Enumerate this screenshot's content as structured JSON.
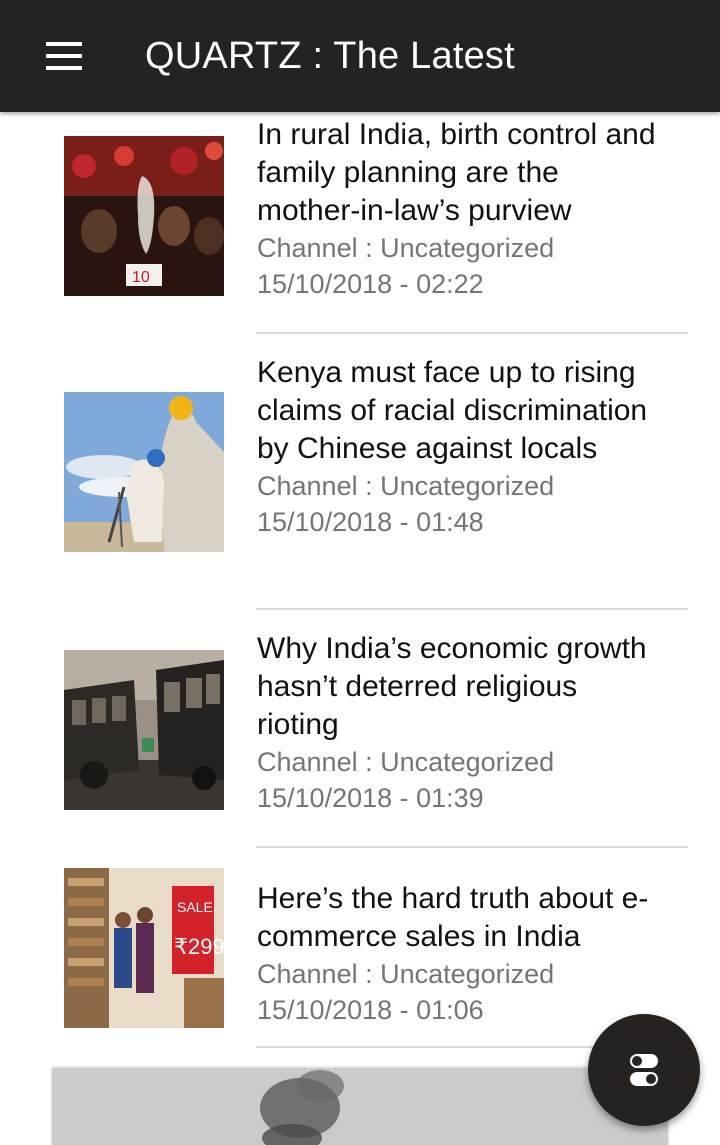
{
  "header": {
    "title": "QUARTZ : The Latest",
    "menu_icon": "hamburger-menu-icon"
  },
  "articles": [
    {
      "title": "In rural India, birth control and family planning are the mother-in-law’s purview",
      "channel": "Channel : Uncategorized",
      "datetime": "15/10/2018 - 02:22"
    },
    {
      "title": "Kenya must face up to rising claims of racial discrimination by Chinese against locals",
      "channel": "Channel : Uncategorized",
      "datetime": "15/10/2018 - 01:48"
    },
    {
      "title": "Why India’s economic growth hasn’t deterred religious rioting",
      "channel": "Channel : Uncategorized",
      "datetime": "15/10/2018 - 01:39"
    },
    {
      "title": "Here’s the hard truth about e-commerce sales in India",
      "channel": "Channel : Uncategorized",
      "datetime": "15/10/2018 - 01:06"
    }
  ],
  "fab": {
    "icon": "filter-toggle-icon"
  },
  "colors": {
    "appbar": "#262220",
    "text_primary": "#111111",
    "text_secondary": "#757575",
    "divider": "#dcdcdc"
  }
}
